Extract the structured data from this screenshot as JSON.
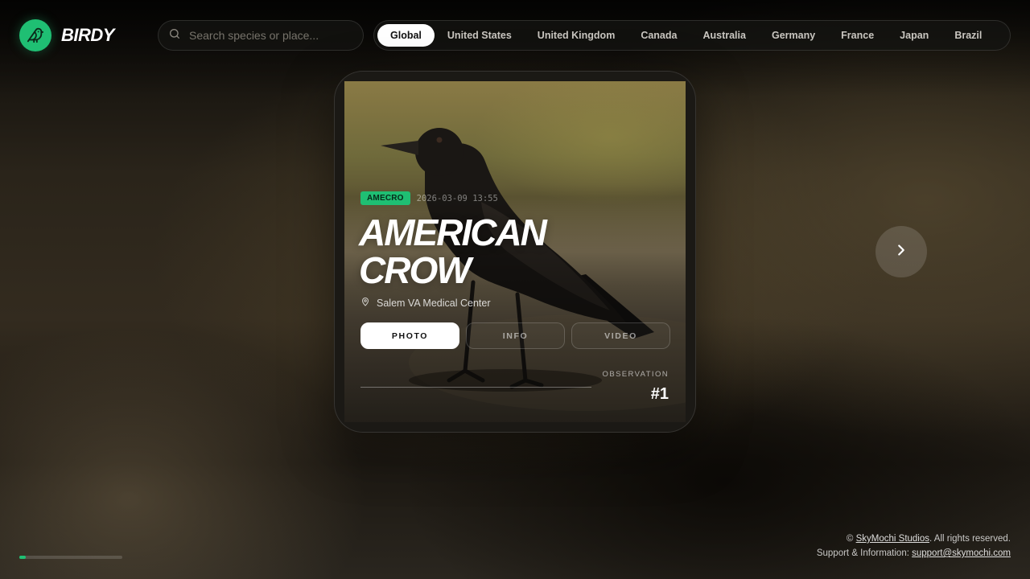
{
  "app": {
    "name": "BIRDY"
  },
  "colors": {
    "accent": "#1fbf73",
    "tab_active_bg": "#ffffff"
  },
  "search": {
    "placeholder": "Search species or place..."
  },
  "regions": {
    "items": [
      {
        "label": "Global",
        "active": true
      },
      {
        "label": "United States",
        "active": false
      },
      {
        "label": "United Kingdom",
        "active": false
      },
      {
        "label": "Canada",
        "active": false
      },
      {
        "label": "Australia",
        "active": false
      },
      {
        "label": "Germany",
        "active": false
      },
      {
        "label": "France",
        "active": false
      },
      {
        "label": "Japan",
        "active": false
      },
      {
        "label": "Brazil",
        "active": false
      }
    ]
  },
  "card": {
    "code": "AMECRO",
    "timestamp": "2026-03-09 13:55",
    "title_line1": "AMERICAN",
    "title_line2": "CROW",
    "location": "Salem VA Medical Center",
    "buttons": {
      "photo": "PHOTO",
      "info": "INFO",
      "video": "VIDEO"
    },
    "active_button": "photo",
    "observation_label": "OBSERVATION",
    "observation_number": "#1"
  },
  "icons": {
    "logo": "bird-icon",
    "search": "search-icon",
    "location": "map-pin-icon",
    "next": "chevron-right-icon"
  },
  "slideshow": {
    "progress": 0.06
  },
  "footer": {
    "copyright_prefix": "©",
    "company_link": "SkyMochi Studios",
    "copyright_suffix": ". All rights reserved.",
    "support_label": "Support & Information:",
    "support_email": "support@skymochi.com"
  }
}
